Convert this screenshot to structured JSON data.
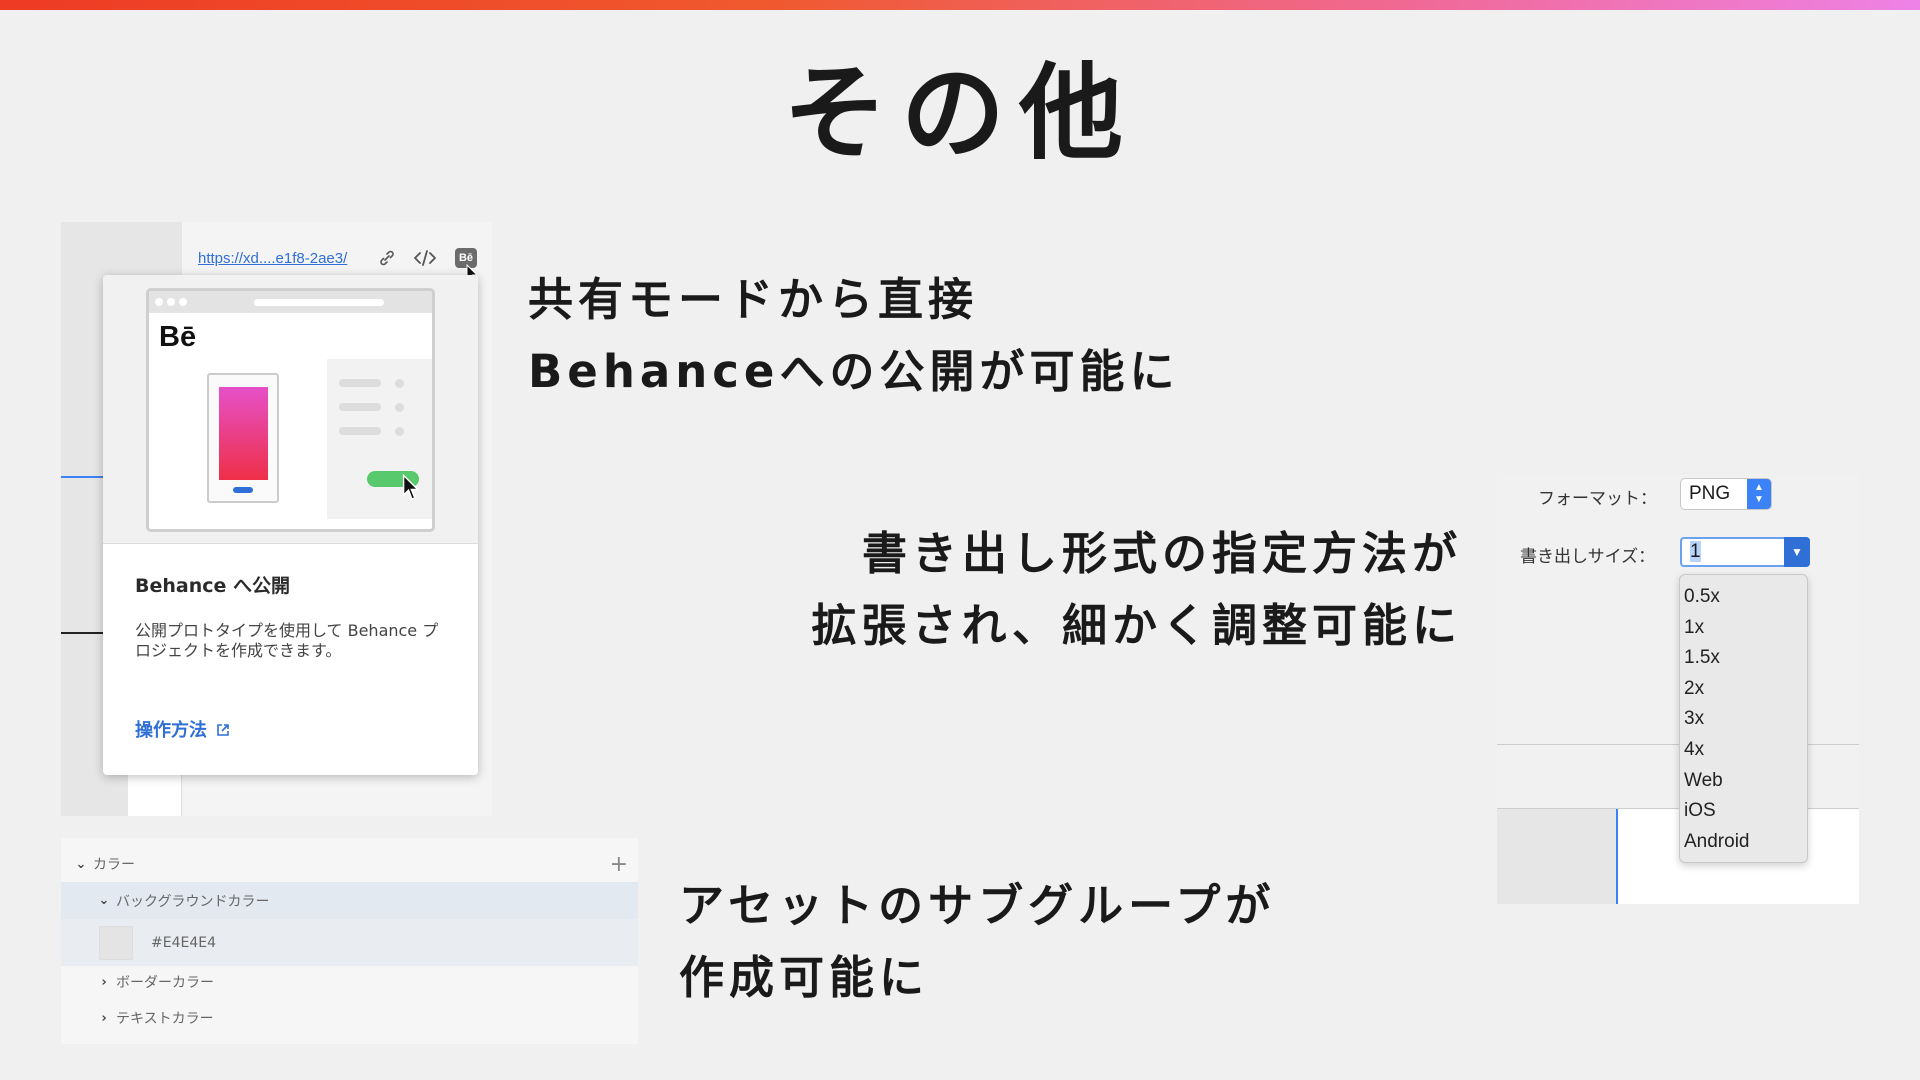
{
  "slide": {
    "title": "その他",
    "caption1": [
      "共有モードから直接",
      "Behanceへの公開が可能に"
    ],
    "caption2": [
      "書き出し形式の指定方法が",
      "拡張され、細かく調整可能に"
    ],
    "caption3": [
      "アセットのサブグループが",
      "作成可能に"
    ]
  },
  "share_panel": {
    "url": "https://xd....e1f8-2ae3/",
    "link_icon": "link-icon",
    "embed_icon": "code-icon",
    "behance_button": "Bē",
    "illustration_logo": "Bē",
    "popover_title": "Behance へ公開",
    "popover_desc": "公開プロトタイプを使用して Behance プロジェクトを作成できます。",
    "popover_link": "操作方法",
    "colors": {
      "link": "#2f6fd6",
      "toggle": "#58c96c"
    }
  },
  "export_panel": {
    "format_label": "フォーマット：",
    "format_value": "PNG",
    "size_label": "書き出しサイズ：",
    "size_value": "1",
    "size_options": [
      "0.5x",
      "1x",
      "1.5x",
      "2x",
      "3x",
      "4x",
      "Web",
      "iOS",
      "Android"
    ]
  },
  "assets_panel": {
    "group": "カラー",
    "subgroup_open": "バックグラウンドカラー",
    "color_value": "#E4E4E4",
    "subgroups_closed": [
      "ボーダーカラー",
      "テキストカラー"
    ]
  }
}
